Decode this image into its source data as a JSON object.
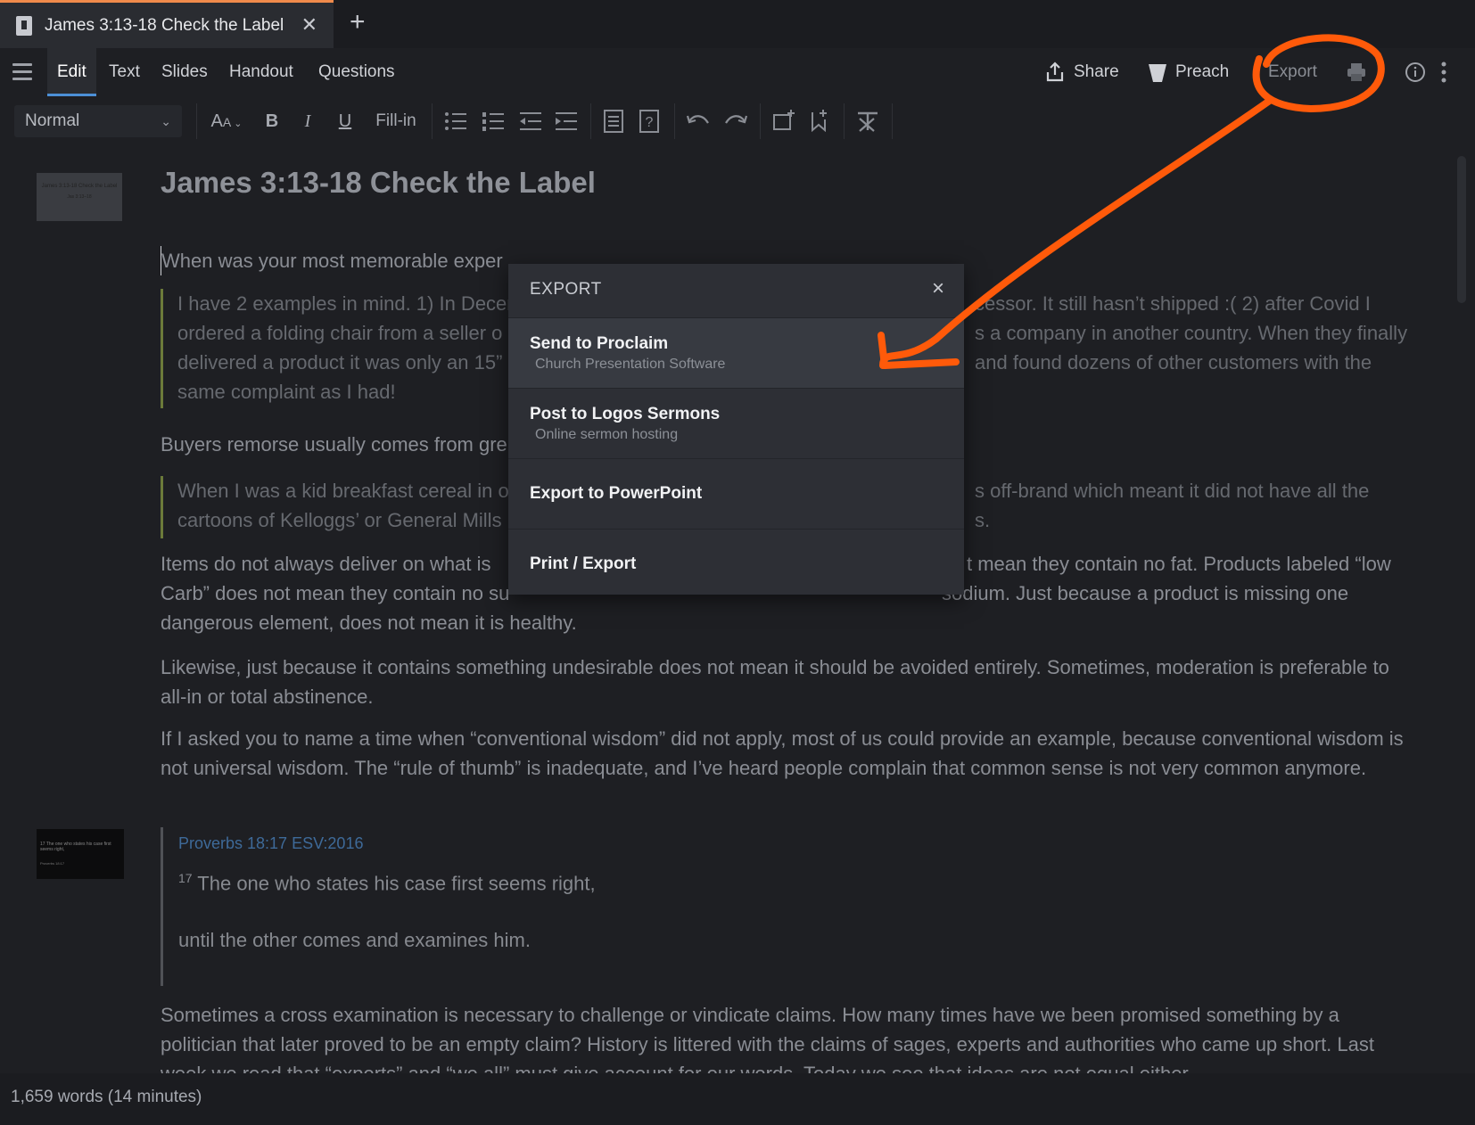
{
  "tab": {
    "title": "James 3:13-18 Check the Label"
  },
  "viewbar": {
    "tabs": [
      "Edit",
      "Text",
      "Slides",
      "Handout",
      "Questions"
    ],
    "share_label": "Share",
    "preach_label": "Preach",
    "export_label": "Export"
  },
  "format": {
    "style_value": "Normal",
    "fillin_label": "Fill-in"
  },
  "document": {
    "title": "James 3:13-18 Check the Label",
    "thumb_title": "James 3:13-18 Check the Label",
    "thumb_sub": "Jas 3:13–18",
    "p1": "When was your most memorable exper",
    "q1_l1a": "I have 2 examples in mind. 1) In Decer",
    "q1_l1b": "cessor. It still hasn’t shipped :(  2) after Covid I",
    "q1_l2a": "ordered a folding chair from a seller o",
    "q1_l2b": "s a company in another country. When they finally",
    "q1_l3a": "delivered a product it was only an 15”",
    "q1_l3b": " and found dozens of other customers with the",
    "q1_l4": "same complaint as I had!",
    "p2": "Buyers remorse usually comes from gre",
    "q2_l1a": "When I was a kid breakfast cereal in o",
    "q2_l1b": "s off-brand which meant it did not have all the",
    "q2_l2a": "cartoons of Kelloggs’ or General Mills",
    "q2_l2b": "s.",
    "p3_l1a": " Items do not always deliver on what is",
    "p3_l1b": "t mean they contain no fat. Products labeled “low",
    "p3_l2a": "Carb” does not mean they contain no su",
    "p3_l2b": "sodium. Just because a product is missing one",
    "p3_l3": "dangerous element, does not mean it is healthy.",
    "p4": "Likewise, just because it contains something undesirable does not mean it should be avoided entirely. Sometimes, moderation is preferable to all-in or total abstinence.",
    "p5": "If I asked you to name a time when “conventional wisdom” did not apply, most of us could provide an example, because conventional wisdom is not universal wisdom. The “rule of thumb” is inadequate, and I’ve heard people complain that common sense is not very common anymore.",
    "scripture_ref": "Proverbs 18:17 ESV:2016",
    "verse_num": "17",
    "verse_line1": " The one who states his case first seems right,",
    "verse_line2": "until the other comes and examines him.",
    "thumb2_text": "17 The one who states his case first seems right,",
    "thumb2_ref": "Proverbs 18:17",
    "p6": "Sometimes a cross examination is necessary to challenge or vindicate claims. How many times have we been promised something by a politician that later proved to be an empty claim? History is littered with the claims of sages, experts and authorities who came up short. Last week we read that “experts” and “we all” must give account for our words. Today we see that ideas are not equal either."
  },
  "status": {
    "word_count": "1,659 words (14 minutes)"
  },
  "modal": {
    "title": "EXPORT",
    "items": [
      {
        "label": "Send to Proclaim",
        "sub": "Church Presentation Software"
      },
      {
        "label": "Post to Logos Sermons",
        "sub": "Online sermon hosting"
      },
      {
        "label": "Export to PowerPoint",
        "sub": ""
      },
      {
        "label": "Print / Export",
        "sub": ""
      }
    ]
  },
  "colors": {
    "accent": "#4c8fd6",
    "annotation": "#ff5a0a",
    "tab_border": "#f08a4b"
  }
}
